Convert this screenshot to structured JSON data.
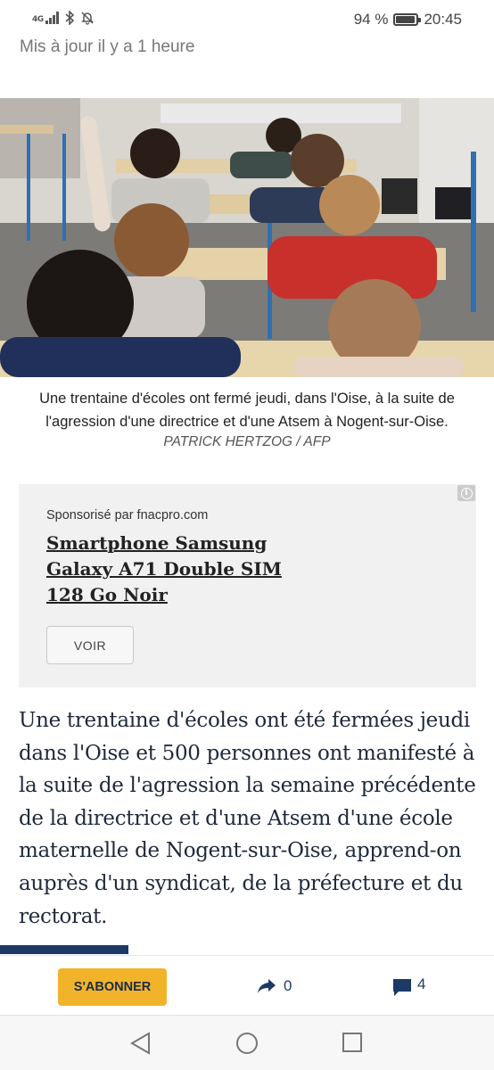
{
  "status_bar": {
    "network_type": "4G",
    "battery_percent": "94 %",
    "battery_level": 0.94,
    "time": "20:45",
    "icons": [
      "signal-icon",
      "bluetooth-icon",
      "notifications-off-icon",
      "battery-icon"
    ]
  },
  "article": {
    "updated": "Mis à jour il y a 1 heure",
    "photo_caption": "Une trentaine d'écoles ont fermé jeudi, dans l'Oise, à la suite de l'agression d'une directrice et d'une Atsem à Nogent-sur-Oise.",
    "photo_credit": "PATRICK HERTZOG / AFP",
    "body": "Une trentaine d'écoles ont été fermées jeudi dans l'Oise et 500 personnes ont manifesté à la suite de l'agression la semaine précédente de la directrice et d'une Atsem d'une école maternelle de Nogent-sur-Oise, apprend-on auprès d'un syndicat, de la préfecture et du rectorat.",
    "reading_progress": 0.26
  },
  "ad": {
    "sponsor": "Sponsorisé par fnacpro.com",
    "title": "Smartphone Samsung Galaxy A71 Double SIM 128 Go Noir",
    "button_label": "VOIR",
    "info_icon": "info-icon"
  },
  "action_bar": {
    "subscribe_label": "S'ABONNER",
    "share_count": "0",
    "comment_count": "4",
    "colors": {
      "subscribe_bg": "#f1b32a",
      "accent": "#1d3a66"
    }
  },
  "nav_bar": {
    "icons": [
      "back-icon",
      "home-icon",
      "recents-icon"
    ]
  }
}
